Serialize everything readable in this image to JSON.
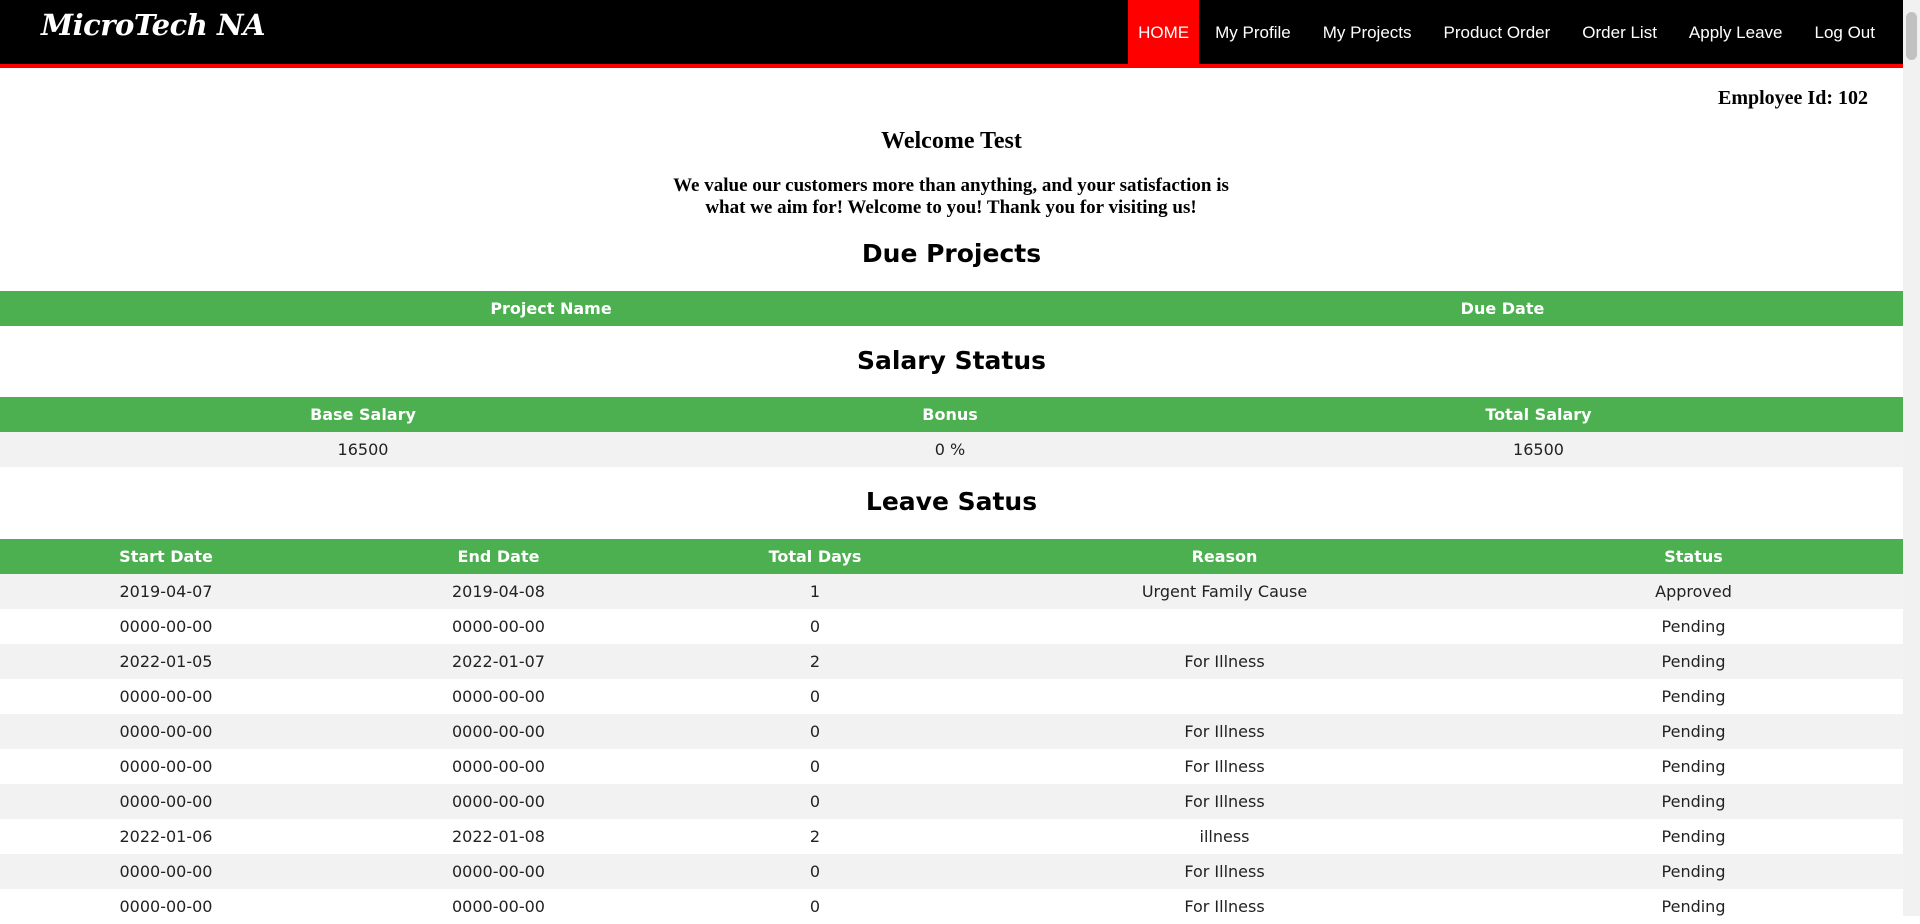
{
  "app": {
    "brand": "MicroTech NA"
  },
  "nav": {
    "items": [
      {
        "label": "HOME",
        "active": true
      },
      {
        "label": "My Profile",
        "active": false
      },
      {
        "label": "My Projects",
        "active": false
      },
      {
        "label": "Product Order",
        "active": false
      },
      {
        "label": "Order List",
        "active": false
      },
      {
        "label": "Apply Leave",
        "active": false
      },
      {
        "label": "Log Out",
        "active": false
      }
    ]
  },
  "header": {
    "employee_id": "Employee Id: 102",
    "welcome": "Welcome Test",
    "tagline": "We value our customers more than anything, and your satisfaction is what we aim for! Welcome to you! Thank you for visiting us!"
  },
  "due_projects": {
    "title": "Due Projects",
    "columns": [
      "Project Name",
      "Due Date"
    ],
    "rows": []
  },
  "salary": {
    "title": "Salary Status",
    "columns": [
      "Base Salary",
      "Bonus",
      "Total Salary"
    ],
    "rows": [
      [
        "16500",
        "0 %",
        "16500"
      ]
    ]
  },
  "leave": {
    "title": "Leave Satus",
    "columns": [
      "Start Date",
      "End Date",
      "Total Days",
      "Reason",
      "Status"
    ],
    "rows": [
      [
        "2019-04-07",
        "2019-04-08",
        "1",
        "Urgent Family Cause",
        "Approved"
      ],
      [
        "0000-00-00",
        "0000-00-00",
        "0",
        "",
        "Pending"
      ],
      [
        "2022-01-05",
        "2022-01-07",
        "2",
        "For Illness",
        "Pending"
      ],
      [
        "0000-00-00",
        "0000-00-00",
        "0",
        "",
        "Pending"
      ],
      [
        "0000-00-00",
        "0000-00-00",
        "0",
        "For Illness",
        "Pending"
      ],
      [
        "0000-00-00",
        "0000-00-00",
        "0",
        "For Illness",
        "Pending"
      ],
      [
        "0000-00-00",
        "0000-00-00",
        "0",
        "For Illness",
        "Pending"
      ],
      [
        "2022-01-06",
        "2022-01-08",
        "2",
        "illness",
        "Pending"
      ],
      [
        "0000-00-00",
        "0000-00-00",
        "0",
        "For Illness",
        "Pending"
      ],
      [
        "0000-00-00",
        "0000-00-00",
        "0",
        "For Illness",
        "Pending"
      ]
    ]
  },
  "colors": {
    "navbar": "#000000",
    "nav_active": "#ff0000",
    "table_header": "#4caf50",
    "row_stripe": "#f2f2f2"
  }
}
